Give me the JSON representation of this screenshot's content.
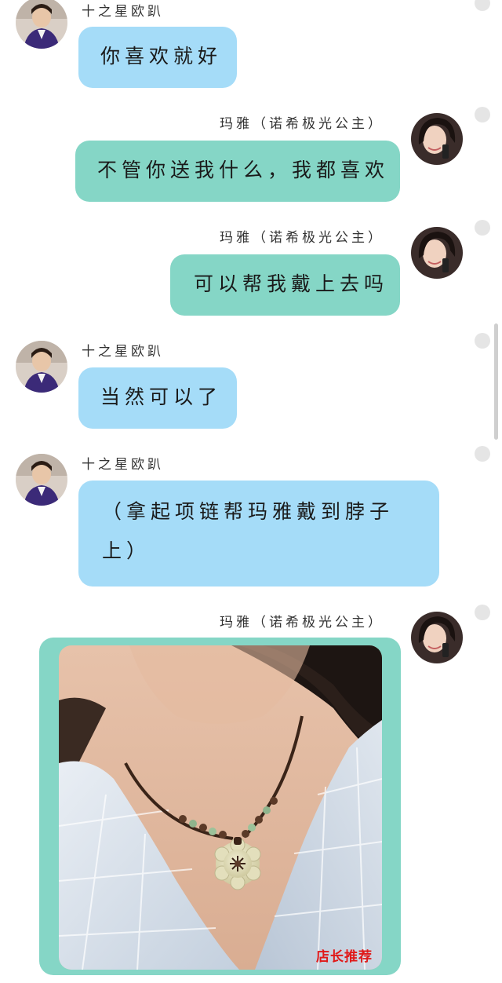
{
  "users": {
    "left_name": "十之星欧趴",
    "right_name": "玛雅（诺希极光公主）"
  },
  "messages": [
    {
      "side": "left",
      "text": "你喜欢就好"
    },
    {
      "side": "right",
      "text": "不管你送我什么，我都喜欢"
    },
    {
      "side": "right",
      "text": "可以帮我戴上去吗"
    },
    {
      "side": "left",
      "text": "当然可以了"
    },
    {
      "side": "left",
      "text_line1": "（拿起项链帮玛雅戴到脖子",
      "text_line2": "上）"
    },
    {
      "side": "right",
      "type": "image",
      "caption": "店长推荐"
    }
  ],
  "colors": {
    "left_bubble": "#a5dcf8",
    "right_bubble": "#85d6c6",
    "caption": "#e01919"
  },
  "icons": {
    "status_dot": "status-dot-icon"
  }
}
